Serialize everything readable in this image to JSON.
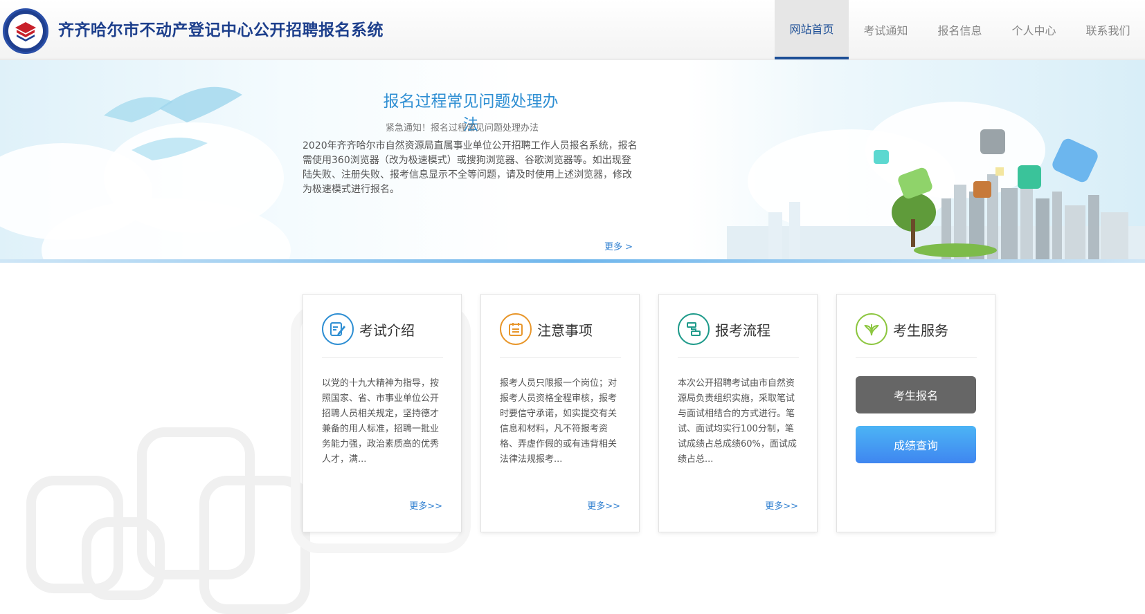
{
  "header": {
    "site_title": "齐齐哈尔市不动产登记中心公开招聘报名系统",
    "logo_icon": "real-estate-registration-seal"
  },
  "nav": {
    "items": [
      {
        "label": "网站首页",
        "active": true
      },
      {
        "label": "考试通知",
        "active": false
      },
      {
        "label": "报名信息",
        "active": false
      },
      {
        "label": "个人中心",
        "active": false
      },
      {
        "label": "联系我们",
        "active": false
      }
    ],
    "active_color": "#1d4f96"
  },
  "banner": {
    "title": "报名过程常见问题处理办法",
    "subtitle": "紧急通知！报名过程常见问题处理办法",
    "text": "2020年齐齐哈尔市自然资源局直属事业单位公开招聘工作人员报名系统，报名需使用360浏览器（改为极速模式）或搜狗浏览器、谷歌浏览器等。如出现登陆失败、注册失败、报考信息显示不全等问题，请及时使用上述浏览器，修改为极速模式进行报名。",
    "more": "更多 >"
  },
  "cards": [
    {
      "title": "考试介绍",
      "icon": "edit-document-icon",
      "color": "#2f8fd3",
      "text": "以党的十九大精神为指导，按照国家、省、市事业单位公开招聘人员相关规定，坚持德才兼备的用人标准，招聘一批业务能力强，政治素质高的优秀人才，满...",
      "more": "更多>>"
    },
    {
      "title": "注意事项",
      "icon": "calendar-icon",
      "color": "#e8962a",
      "text": "报考人员只限报一个岗位；对报考人员资格全程审核，报考时要信守承诺，如实提交有关信息和材料，凡不符报考资格、弄虚作假的或有违背相关法律法规报考...",
      "more": "更多>>"
    },
    {
      "title": "报考流程",
      "icon": "flow-chart-icon",
      "color": "#1e9a8a",
      "text": "本次公开招聘考试由市自然资源局负责组织实施，采取笔试与面试相结合的方式进行。笔试、面试均实行100分制，笔试成绩占总成绩60%，面试成绩占总...",
      "more": "更多>>"
    },
    {
      "title": "考生服务",
      "icon": "leaf-service-icon",
      "color": "#8cc63f",
      "buttons": [
        {
          "label": "考生报名",
          "color": "#666666"
        },
        {
          "label": "成绩查询",
          "color": "#3f9cf0"
        }
      ]
    }
  ]
}
